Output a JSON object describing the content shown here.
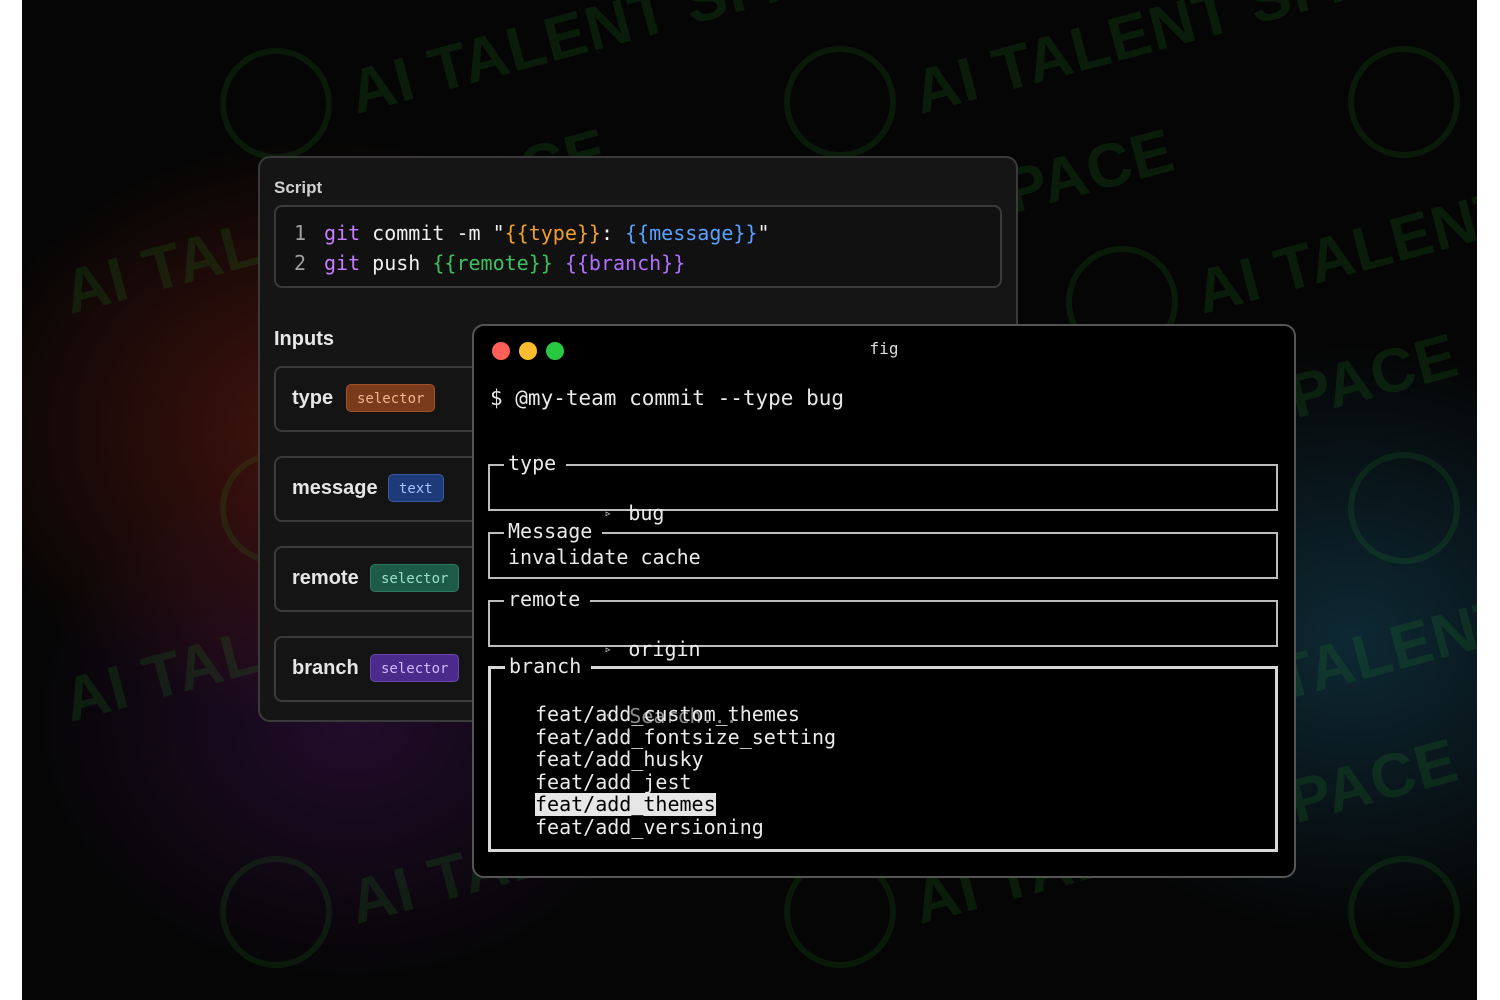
{
  "watermark": "AI TALENT SPACE",
  "script_panel": {
    "title": "Script",
    "lines": [
      {
        "num": "1",
        "segments": [
          {
            "text": "git",
            "cls": "tok-kw"
          },
          {
            "text": " commit -m \"",
            "cls": ""
          },
          {
            "text": "{{type}}",
            "cls": "tok-orange"
          },
          {
            "text": ": ",
            "cls": ""
          },
          {
            "text": "{{message}}",
            "cls": "tok-blue"
          },
          {
            "text": "\"",
            "cls": ""
          }
        ]
      },
      {
        "num": "2",
        "segments": [
          {
            "text": "git",
            "cls": "tok-kw"
          },
          {
            "text": " push ",
            "cls": ""
          },
          {
            "text": "{{remote}}",
            "cls": "tok-green"
          },
          {
            "text": " ",
            "cls": ""
          },
          {
            "text": "{{branch}}",
            "cls": "tok-purple"
          }
        ]
      }
    ]
  },
  "inputs_panel": {
    "title": "Inputs",
    "inputs": [
      {
        "name": "type",
        "badge": "selector"
      },
      {
        "name": "message",
        "badge": "text"
      },
      {
        "name": "remote",
        "badge": "selector"
      },
      {
        "name": "branch",
        "badge": "selector"
      }
    ]
  },
  "terminal": {
    "title": "fig",
    "prompt": "$ @my-team commit --type bug",
    "fields": {
      "type": {
        "label": "type",
        "value": "bug"
      },
      "message": {
        "label": "Message",
        "value": "invalidate cache"
      },
      "remote": {
        "label": "remote",
        "value": "origin"
      },
      "branch": {
        "label": "branch",
        "search_placeholder": "Search...",
        "options": [
          "feat/add_custom_themes",
          "feat/add_fontsize_setting",
          "feat/add_husky",
          "feat/add_jest",
          "feat/add_themes",
          "feat/add_versioning"
        ],
        "selected": "feat/add_themes"
      }
    },
    "caret_collapsed": "▹",
    "caret_expanded": "▿"
  }
}
